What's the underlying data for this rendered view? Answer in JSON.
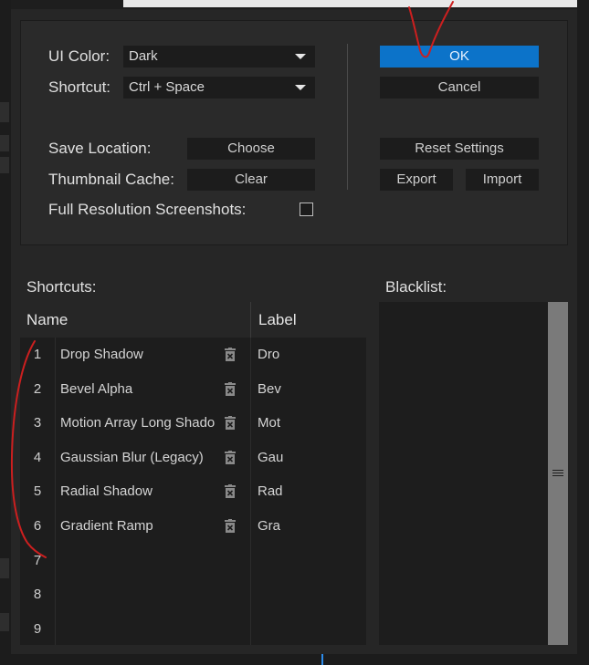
{
  "settings": {
    "ui_color_label": "UI Color:",
    "ui_color_value": "Dark",
    "shortcut_label": "Shortcut:",
    "shortcut_value": "Ctrl + Space",
    "save_location_label": "Save Location:",
    "save_location_button": "Choose",
    "thumbnail_cache_label": "Thumbnail Cache:",
    "thumbnail_cache_button": "Clear",
    "full_res_label": "Full Resolution Screenshots:",
    "full_res_checked": false
  },
  "actions": {
    "ok": "OK",
    "cancel": "Cancel",
    "reset": "Reset Settings",
    "export": "Export",
    "import": "Import"
  },
  "shortcuts": {
    "title": "Shortcuts:",
    "columns": {
      "name": "Name",
      "label": "Label"
    },
    "rows": [
      {
        "num": "1",
        "name": "Drop Shadow",
        "label": "Dro"
      },
      {
        "num": "2",
        "name": "Bevel Alpha",
        "label": "Bev"
      },
      {
        "num": "3",
        "name": "Motion Array Long Shado",
        "label": "Mot"
      },
      {
        "num": "4",
        "name": "Gaussian Blur (Legacy)",
        "label": "Gau"
      },
      {
        "num": "5",
        "name": "Radial Shadow",
        "label": "Rad"
      },
      {
        "num": "6",
        "name": "Gradient Ramp",
        "label": "Gra"
      },
      {
        "num": "7",
        "name": "",
        "label": ""
      },
      {
        "num": "8",
        "name": "",
        "label": ""
      },
      {
        "num": "9",
        "name": "",
        "label": ""
      }
    ]
  },
  "blacklist": {
    "title": "Blacklist:"
  },
  "colors": {
    "accent": "#0c73c9",
    "annotation": "#cc1f1f"
  },
  "icons": {
    "row_delete": "trash-icon",
    "scroll_grip": "grip-icon"
  }
}
